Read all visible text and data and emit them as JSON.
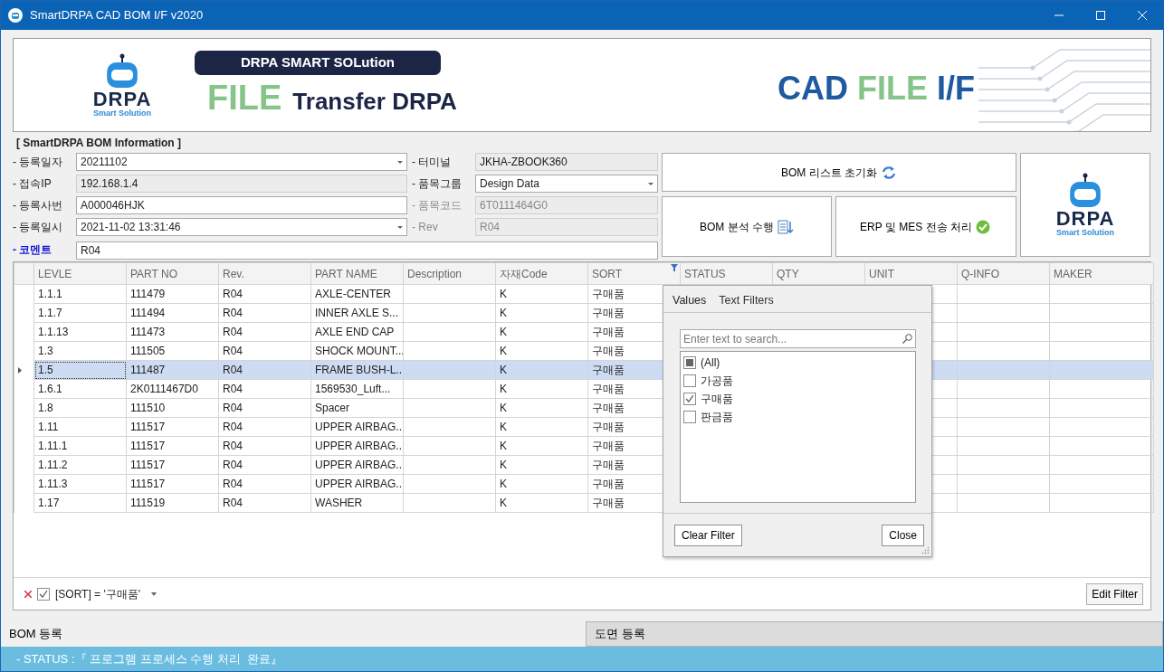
{
  "window": {
    "title": "SmartDRPA CAD BOM I/F v2020"
  },
  "banner": {
    "logo_text": "DRPA",
    "logo_subtext": "Smart Solution",
    "pill": "DRPA SMART SOLution",
    "headline_accent": "FILE",
    "headline": "Transfer DRPA",
    "right_title": [
      {
        "text": "CAD",
        "accent": false
      },
      {
        "text": "FILE",
        "accent": true
      },
      {
        "text": "I/F",
        "accent": false
      }
    ]
  },
  "section_title": "[ SmartDRPA BOM Information ]",
  "fields": [
    {
      "label": "- 등록일자",
      "value": "20211102",
      "kind": "combo",
      "readonly": false,
      "disabled": false,
      "accent": false
    },
    {
      "label": "- 터미널",
      "value": "JKHA-ZBOOK360",
      "kind": "text",
      "readonly": true,
      "disabled": false,
      "accent": false
    },
    {
      "label": "- 접속IP",
      "value": "192.168.1.4",
      "kind": "text",
      "readonly": true,
      "disabled": false,
      "accent": false
    },
    {
      "label": "- 품목그룹",
      "value": "Design Data",
      "kind": "combo",
      "readonly": false,
      "disabled": false,
      "accent": false
    },
    {
      "label": "- 등록사번",
      "value": "A000046HJK",
      "kind": "text",
      "readonly": false,
      "disabled": false,
      "accent": false
    },
    {
      "label": "- 품목코드",
      "value": "6T0111464G0",
      "kind": "text",
      "readonly": true,
      "disabled": true,
      "accent": false
    },
    {
      "label": "- 등록일시",
      "value": "2021-11-02 13:31:46",
      "kind": "combo",
      "readonly": false,
      "disabled": false,
      "accent": false
    },
    {
      "label": "- Rev",
      "value": "R04",
      "kind": "text",
      "readonly": true,
      "disabled": true,
      "accent": false
    },
    {
      "label": "- 코멘트",
      "value": "R04",
      "kind": "wide",
      "readonly": false,
      "disabled": false,
      "accent": true
    }
  ],
  "buttons": [
    {
      "label": "BOM 리스트 초기화",
      "kind": "refresh"
    },
    {
      "label": "BOM 분석 수행",
      "kind": "analyze"
    },
    {
      "label": "ERP 및 MES 전송 처리",
      "kind": "send"
    }
  ],
  "side_logo": {
    "text": "DRPA",
    "subtext": "Smart Solution"
  },
  "table": {
    "columns": [
      {
        "label": "LEVLE",
        "filtered": false
      },
      {
        "label": "PART NO",
        "filtered": false
      },
      {
        "label": "Rev.",
        "filtered": false
      },
      {
        "label": "PART NAME",
        "filtered": false
      },
      {
        "label": "Description",
        "filtered": false
      },
      {
        "label": "자재Code",
        "filtered": false
      },
      {
        "label": "SORT",
        "filtered": true
      },
      {
        "label": "STATUS",
        "filtered": false
      },
      {
        "label": "QTY",
        "filtered": false
      },
      {
        "label": "UNIT",
        "filtered": false
      },
      {
        "label": "Q-INFO",
        "filtered": false
      },
      {
        "label": "MAKER",
        "filtered": false
      }
    ],
    "rows": [
      {
        "selected": false,
        "cells": [
          "1.1.1",
          "111479",
          "R04",
          "AXLE-CENTER",
          "",
          "K",
          "구매품"
        ]
      },
      {
        "selected": false,
        "cells": [
          "1.1.7",
          "111494",
          "R04",
          "INNER AXLE S...",
          "",
          "K",
          "구매품"
        ]
      },
      {
        "selected": false,
        "cells": [
          "1.1.13",
          "111473",
          "R04",
          "AXLE END CAP",
          "",
          "K",
          "구매품"
        ]
      },
      {
        "selected": false,
        "cells": [
          "1.3",
          "111505",
          "R04",
          "SHOCK MOUNT...",
          "",
          "K",
          "구매품"
        ]
      },
      {
        "selected": true,
        "cells": [
          "1.5",
          "111487",
          "R04",
          "FRAME BUSH-L...",
          "",
          "K",
          "구매품"
        ]
      },
      {
        "selected": false,
        "cells": [
          "1.6.1",
          "2K0111467D0",
          "R04",
          "1569530_Luft...",
          "",
          "K",
          "구매품"
        ]
      },
      {
        "selected": false,
        "cells": [
          "1.8",
          "111510",
          "R04",
          "Spacer",
          "",
          "K",
          "구매품"
        ]
      },
      {
        "selected": false,
        "cells": [
          "1.11",
          "111517",
          "R04",
          "UPPER AIRBAG...",
          "",
          "K",
          "구매품"
        ]
      },
      {
        "selected": false,
        "cells": [
          "1.11.1",
          "111517",
          "R04",
          "UPPER AIRBAG...",
          "",
          "K",
          "구매품"
        ]
      },
      {
        "selected": false,
        "cells": [
          "1.11.2",
          "111517",
          "R04",
          "UPPER AIRBAG...",
          "",
          "K",
          "구매품"
        ]
      },
      {
        "selected": false,
        "cells": [
          "1.11.3",
          "111517",
          "R04",
          "UPPER AIRBAG...",
          "",
          "K",
          "구매품"
        ]
      },
      {
        "selected": false,
        "cells": [
          "1.17",
          "111519",
          "R04",
          "WASHER",
          "",
          "K",
          "구매품"
        ]
      }
    ]
  },
  "filter_popup": {
    "tabs": [
      {
        "label": "Values",
        "selected": true
      },
      {
        "label": "Text Filters",
        "selected": false
      }
    ],
    "search": {
      "placeholder": "Enter text to search..."
    },
    "items": [
      {
        "label": "(All)",
        "checked": false,
        "mixed": true
      },
      {
        "label": "가공품",
        "checked": false,
        "mixed": false
      },
      {
        "label": "구매품",
        "checked": true,
        "mixed": false
      },
      {
        "label": "판금품",
        "checked": false,
        "mixed": false
      }
    ],
    "buttons": [
      "Clear Filter",
      "Close"
    ]
  },
  "filter_bar": {
    "enabled": true,
    "expression": "[SORT] = '구매품'",
    "button": "Edit Filter"
  },
  "bottom_tabs": [
    {
      "label": "BOM 등록",
      "selected": true
    },
    {
      "label": "도면 등록",
      "selected": false
    }
  ],
  "status_bar": "- STATUS :『 프로그램 프로세스 수행 처리  완료』"
}
